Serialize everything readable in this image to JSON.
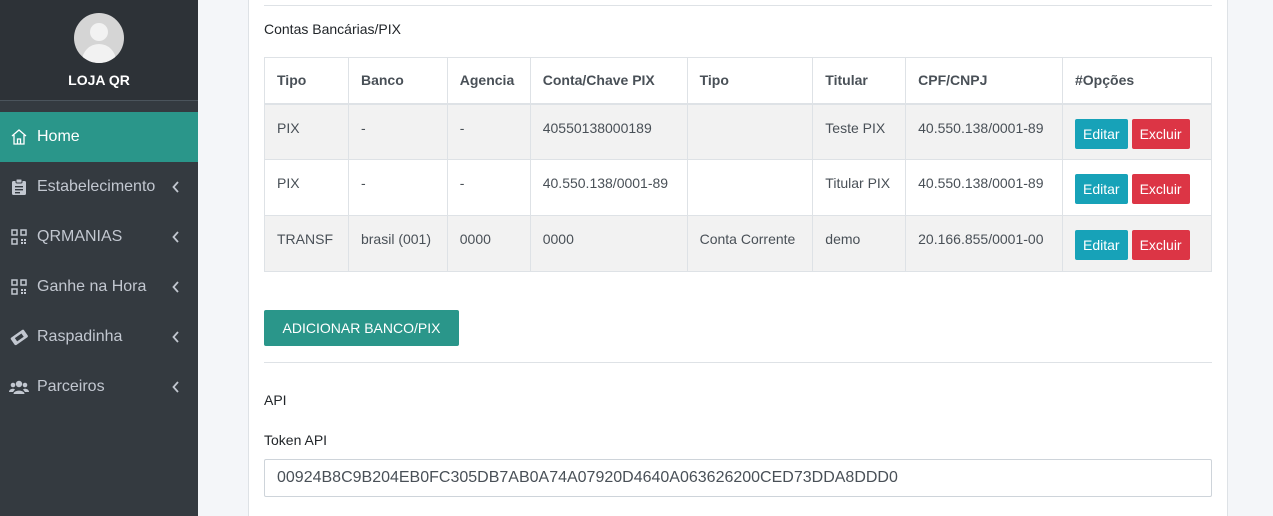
{
  "sidebar": {
    "user_name": "LOJA QR",
    "items": [
      {
        "label": "Home",
        "icon": "home-icon",
        "active": true
      },
      {
        "label": "Estabelecimento",
        "icon": "clipboard-icon"
      },
      {
        "label": "QRMANIAS",
        "icon": "qrcode-icon"
      },
      {
        "label": "Ganhe na Hora",
        "icon": "qrcode-icon"
      },
      {
        "label": "Raspadinha",
        "icon": "ticket-icon"
      },
      {
        "label": "Parceiros",
        "icon": "users-icon"
      }
    ],
    "active_color": "#2a968a"
  },
  "accounts": {
    "section_title": "Contas Bancárias/PIX",
    "headers": [
      "Tipo",
      "Banco",
      "Agencia",
      "Conta/Chave PIX",
      "Tipo",
      "Titular",
      "CPF/CNPJ",
      "#Opções"
    ],
    "rows": [
      {
        "tipo": "PIX",
        "banco": "-",
        "agencia": "-",
        "conta": "40550138000189",
        "tipo_conta": "",
        "titular": "Teste PIX",
        "cpf_cnpj": "40.550.138/0001-89"
      },
      {
        "tipo": "PIX",
        "banco": "-",
        "agencia": "-",
        "conta": "40.550.138/0001-89",
        "tipo_conta": "",
        "titular": "Titular PIX",
        "cpf_cnpj": "40.550.138/0001-89"
      },
      {
        "tipo": "TRANSF",
        "banco": "brasil (001)",
        "agencia": "0000",
        "conta": "0000",
        "tipo_conta": "Conta Corrente",
        "titular": "demo",
        "cpf_cnpj": "20.166.855/0001-00"
      }
    ],
    "edit_label": "Editar",
    "delete_label": "Excluir",
    "add_button": "ADICIONAR BANCO/PIX"
  },
  "api": {
    "section_title": "API",
    "token_label": "Token API",
    "token_value": "00924B8C9B204EB0FC305DB7AB0A74A07920D4640A063626200CED73DDA8DDD0"
  }
}
